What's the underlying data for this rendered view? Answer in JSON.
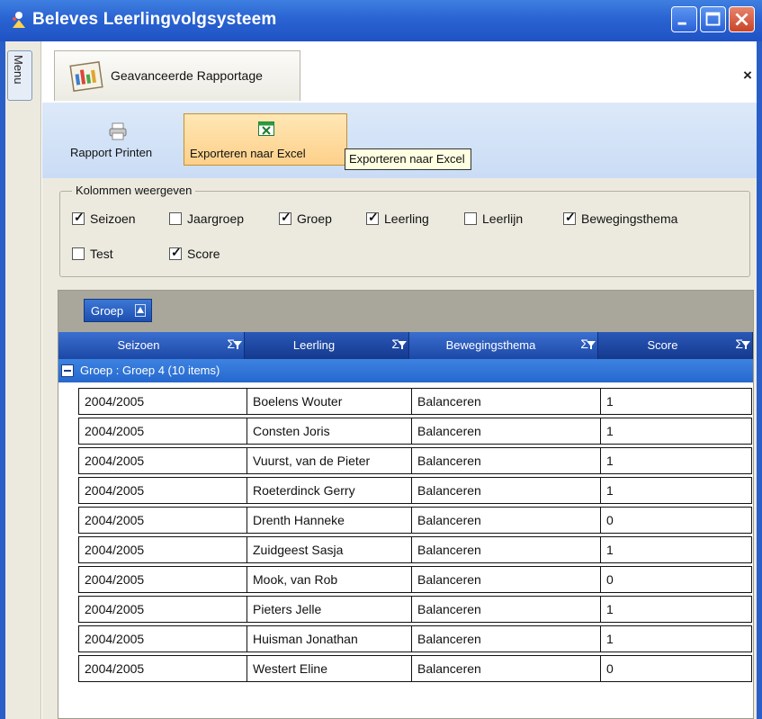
{
  "window": {
    "title": "Beleves Leerlingvolgsysteem",
    "controls": [
      "minimize",
      "maximize",
      "close"
    ]
  },
  "menu_tab": {
    "label": "Menu"
  },
  "document_tab": {
    "label": "Geavanceerde Rapportage",
    "close_label": "×",
    "icon": "report-chart-icon"
  },
  "toolbar": {
    "print": {
      "label": "Rapport Printen",
      "icon": "printer-icon"
    },
    "export_excel": {
      "label": "Exporteren naar Excel",
      "icon": "excel-icon"
    },
    "tooltip": "Exporteren naar Excel"
  },
  "columns_group": {
    "title": "Kolommen weergeven",
    "checkboxes": [
      {
        "label": "Seizoen",
        "checked": true
      },
      {
        "label": "Jaargroep",
        "checked": false
      },
      {
        "label": "Groep",
        "checked": true
      },
      {
        "label": "Leerling",
        "checked": true
      },
      {
        "label": "Leerlijn",
        "checked": false
      },
      {
        "label": "Bewegingsthema",
        "checked": true
      },
      {
        "label": "Test",
        "checked": false
      },
      {
        "label": "Score",
        "checked": true
      }
    ]
  },
  "grid": {
    "group_by_chip": "Groep",
    "columns": [
      "Seizoen",
      "Leerling",
      "Bewegingsthema",
      "Score"
    ],
    "sigma_symbol": "Σ",
    "group_header": "Groep : Groep 4 (10 items)",
    "rows": [
      [
        "2004/2005",
        "Boelens Wouter",
        "Balanceren",
        "1"
      ],
      [
        "2004/2005",
        "Consten Joris",
        "Balanceren",
        "1"
      ],
      [
        "2004/2005",
        "Vuurst, van de Pieter",
        "Balanceren",
        "1"
      ],
      [
        "2004/2005",
        "Roeterdinck Gerry",
        "Balanceren",
        "1"
      ],
      [
        "2004/2005",
        "Drenth Hanneke",
        "Balanceren",
        "0"
      ],
      [
        "2004/2005",
        "Zuidgeest Sasja",
        "Balanceren",
        "1"
      ],
      [
        "2004/2005",
        "Mook, van Rob",
        "Balanceren",
        "0"
      ],
      [
        "2004/2005",
        "Pieters Jelle",
        "Balanceren",
        "1"
      ],
      [
        "2004/2005",
        "Huisman Jonathan",
        "Balanceren",
        "1"
      ],
      [
        "2004/2005",
        "Westert Eline",
        "Balanceren",
        "0"
      ]
    ]
  },
  "colors": {
    "titlebar": "#2a63d2",
    "header_blue": "#1c48a6",
    "group_row_blue": "#2668cf",
    "excel_highlight": "#fdd08a",
    "toolbar_bg": "#cadcf5",
    "panel_bg": "#eceadf"
  }
}
